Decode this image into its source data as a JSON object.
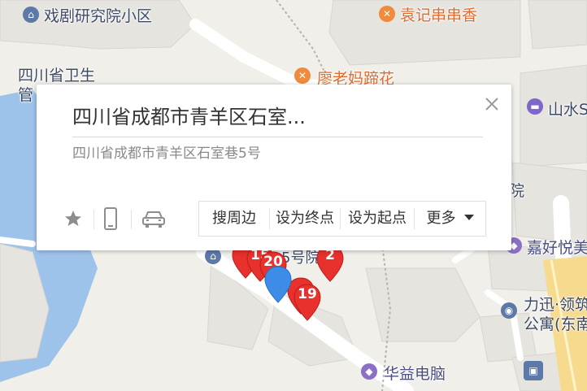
{
  "map": {
    "labels": {
      "xiju": "戏剧研究院小区",
      "yuanji": "袁记串串香",
      "sichuan_weisheng": "四川省卫生",
      "guan": "管",
      "liaolaoma": "廖老妈蹄花",
      "shanshui": "山水S",
      "yuan": "院",
      "jiahao": "嘉好悦美",
      "lixun": "力迅·领筑",
      "gongyu": "公寓(东南",
      "huayi": "华益电脑",
      "wuhaoyuan": "5号院"
    },
    "markers": {
      "m15": "15",
      "m20": "20",
      "m2": "2",
      "m19": "19"
    },
    "icons": {
      "residential": "building-icon",
      "food": "fork-knife-icon",
      "hotel": "bed-icon",
      "shop": "shopping-bag-icon",
      "bus": "bus-icon",
      "location": "location-pin-icon"
    },
    "colors": {
      "marker_red": "#e8302c",
      "current_location": "#3d8de8",
      "food_text": "#e26b2b",
      "place_text": "#3d4a66"
    }
  },
  "popup": {
    "title": "四川省成都市青羊区石室...",
    "address": "四川省成都市青羊区石室巷5号",
    "actions": {
      "nearby": "搜周边",
      "set_end": "设为终点",
      "set_start": "设为起点",
      "more": "更多"
    },
    "tool_icons": [
      "star-icon",
      "phone-icon",
      "car-icon"
    ]
  }
}
